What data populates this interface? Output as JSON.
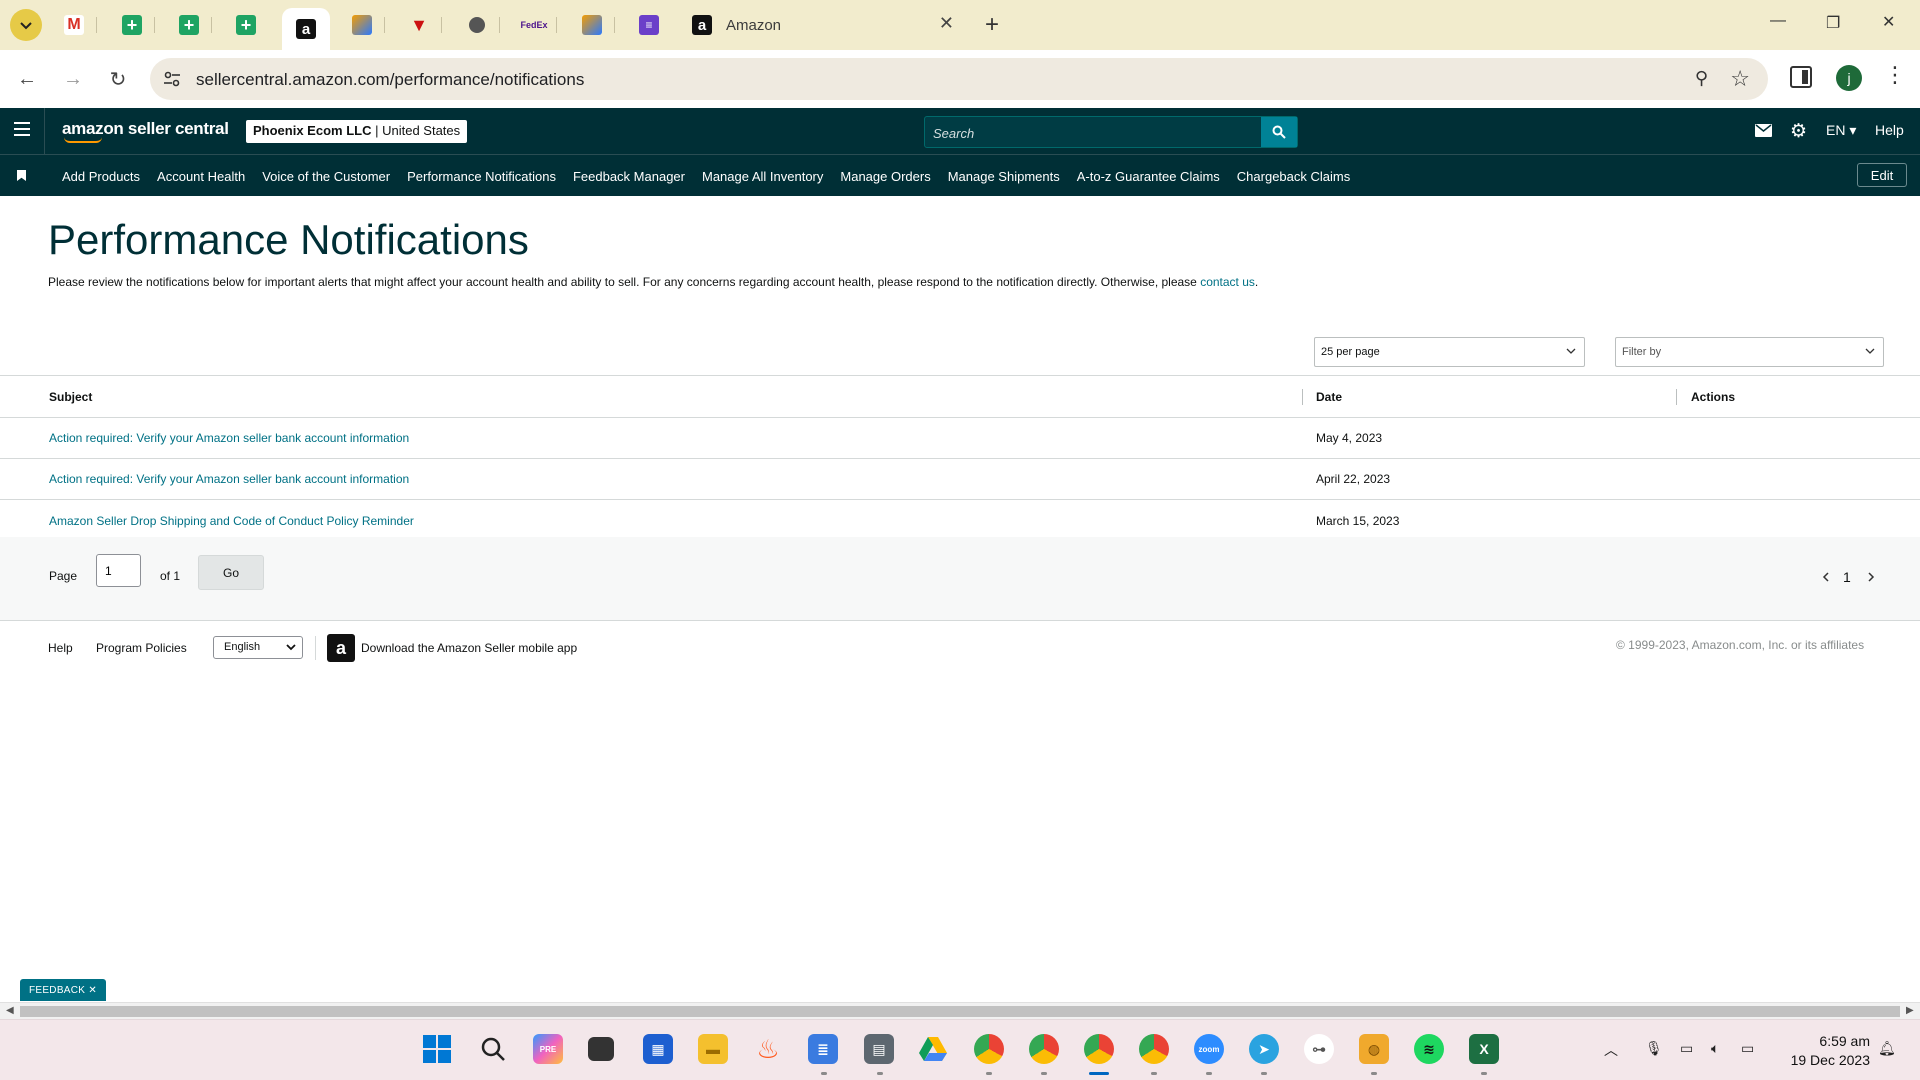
{
  "browser": {
    "tab_title": "Amazon",
    "url": "sellercentral.amazon.com/performance/notifications",
    "profile_initial": "j",
    "fedex_label": "FedEx"
  },
  "header": {
    "logo": "amazon seller central",
    "account": "Phoenix Ecom LLC",
    "marketplace": "United States",
    "search_placeholder": "Search",
    "language": "EN",
    "help": "Help"
  },
  "nav": {
    "items": [
      "Add Products",
      "Account Health",
      "Voice of the Customer",
      "Performance Notifications",
      "Feedback Manager",
      "Manage All Inventory",
      "Manage Orders",
      "Manage Shipments",
      "A-to-z Guarantee Claims",
      "Chargeback Claims"
    ],
    "edit": "Edit"
  },
  "page": {
    "title": "Performance Notifications",
    "intro": "Please review the notifications below for important alerts that might affect your account health and ability to sell. For any concerns regarding account health, please respond to the notification directly. Otherwise, please",
    "contact_link": "contact us",
    "per_page": "25 per page",
    "filter_placeholder": "Filter by"
  },
  "table": {
    "columns": [
      "Subject",
      "Date",
      "Actions"
    ],
    "rows": [
      {
        "subject": "Action required: Verify your Amazon seller bank account information",
        "date": "May 4, 2023"
      },
      {
        "subject": "Action required: Verify your Amazon seller bank account information",
        "date": "April 22, 2023"
      },
      {
        "subject": "Amazon Seller Drop Shipping and Code of Conduct Policy Reminder",
        "date": "March 15, 2023"
      }
    ]
  },
  "pager": {
    "page_label": "Page",
    "page_value": "1",
    "of_label": "of 1",
    "go": "Go",
    "current_page": "1"
  },
  "footer": {
    "help": "Help",
    "program_policies": "Program Policies",
    "language": "English",
    "app_text": "Download the Amazon Seller mobile app",
    "copyright": "© 1999-2023, Amazon.com, Inc. or its affiliates"
  },
  "feedback": "FEEDBACK",
  "taskbar": {
    "time": "6:59 am",
    "date": "19 Dec 2023",
    "apps": [
      "start",
      "search",
      "copilot",
      "file-explorer-dark",
      "store",
      "files",
      "fire",
      "notepad",
      "calculator",
      "google-drive",
      "chrome-1",
      "chrome-2",
      "chrome-active",
      "chrome-4",
      "zoom",
      "telegram",
      "authenticator",
      "jar",
      "spotify",
      "excel"
    ]
  },
  "colors": {
    "sc_header": "#002f36",
    "link": "#007185",
    "tabbar": "#f2eccd",
    "taskbar": "#f3e7ea"
  }
}
